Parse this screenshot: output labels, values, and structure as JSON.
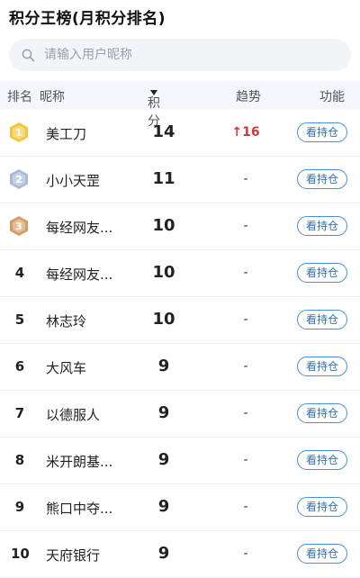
{
  "title": "积分王榜(月积分排名)",
  "search": {
    "placeholder": "请输入用户昵称",
    "icon": "search-icon"
  },
  "header": {
    "rank": "排名",
    "nickname": "昵称",
    "score": "积分",
    "trend": "趋势",
    "function": "功能"
  },
  "colors": {
    "gold": "#f3c53a",
    "silver": "#a9b9d8",
    "bronze": "#d59c63",
    "button_border": "#4a90d9",
    "trend_up": "#d23a3a"
  },
  "rows": [
    {
      "rank": "1",
      "badge": "gold",
      "nickname": "美工刀",
      "score": "14",
      "trend": "↑16",
      "trend_up": true,
      "button": "看持仓"
    },
    {
      "rank": "2",
      "badge": "silver",
      "nickname": "小小天罡",
      "score": "11",
      "trend": "-",
      "trend_up": false,
      "button": "看持仓"
    },
    {
      "rank": "3",
      "badge": "bronze",
      "nickname": "每经网友...",
      "score": "10",
      "trend": "-",
      "trend_up": false,
      "button": "看持仓"
    },
    {
      "rank": "4",
      "badge": "",
      "nickname": "每经网友...",
      "score": "10",
      "trend": "-",
      "trend_up": false,
      "button": "看持仓"
    },
    {
      "rank": "5",
      "badge": "",
      "nickname": "林志玲",
      "score": "10",
      "trend": "-",
      "trend_up": false,
      "button": "看持仓"
    },
    {
      "rank": "6",
      "badge": "",
      "nickname": "大风车",
      "score": "9",
      "trend": "-",
      "trend_up": false,
      "button": "看持仓"
    },
    {
      "rank": "7",
      "badge": "",
      "nickname": "以德服人",
      "score": "9",
      "trend": "-",
      "trend_up": false,
      "button": "看持仓"
    },
    {
      "rank": "8",
      "badge": "",
      "nickname": "米开朗基...",
      "score": "9",
      "trend": "-",
      "trend_up": false,
      "button": "看持仓"
    },
    {
      "rank": "9",
      "badge": "",
      "nickname": "熊口中夺...",
      "score": "9",
      "trend": "-",
      "trend_up": false,
      "button": "看持仓"
    },
    {
      "rank": "10",
      "badge": "",
      "nickname": "天府银行",
      "score": "9",
      "trend": "-",
      "trend_up": false,
      "button": "看持仓"
    }
  ]
}
